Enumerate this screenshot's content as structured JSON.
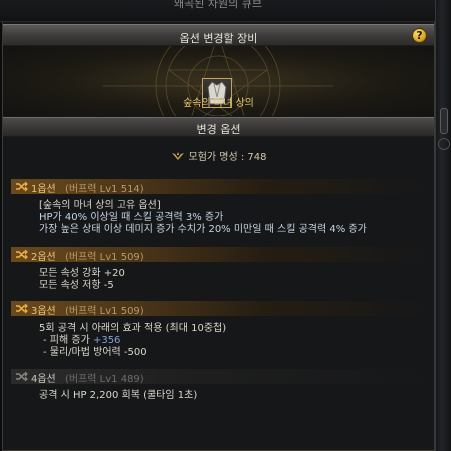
{
  "window": {
    "title": "왜곡된 차원의 큐브"
  },
  "header": {
    "title": "옵션 변경할 장비",
    "help": "?"
  },
  "item": {
    "name": "숲속의 마녀 상의",
    "icon": "robe-armor-icon"
  },
  "section": {
    "title": "변경 옵션"
  },
  "fame": {
    "label": "모험가 명성 : 748",
    "icon": "fame-wings-icon"
  },
  "options": [
    {
      "label": "1옵션",
      "sub": "(버프력 Lv1 514)",
      "lines": [
        "[숲속의 마녀 상의 고유 옵션]",
        "HP가 40% 이상일 때 스킬 공격력 3% 증가",
        "가장 높은 상태 이상 데미지 증가 수치가 20% 미만일 때 스킬 공격력 4% 증가"
      ]
    },
    {
      "label": "2옵션",
      "sub": "(버프력 Lv1 509)",
      "lines": [
        "모든 속성 강화 +20",
        "모든 속성 저항 -5"
      ]
    },
    {
      "label": "3옵션",
      "sub": "(버프력 Lv1 509)",
      "lines": [
        "5회 공격 시 아래의 효과 적용 (최대 10중첩)",
        "- 피해 증가 ",
        "- 물리/마법 방어력 -500"
      ],
      "damage_value": "+356"
    },
    {
      "label": "4옵션",
      "sub": "(버프력 Lv1 489)",
      "lines": [
        "공격 시 HP 2,200 회복 (쿨타임 1초)"
      ]
    }
  ],
  "colors": {
    "accent_gold": "#e7c96f",
    "option_label": "#f0c27a",
    "panel_bg": "#161719"
  }
}
